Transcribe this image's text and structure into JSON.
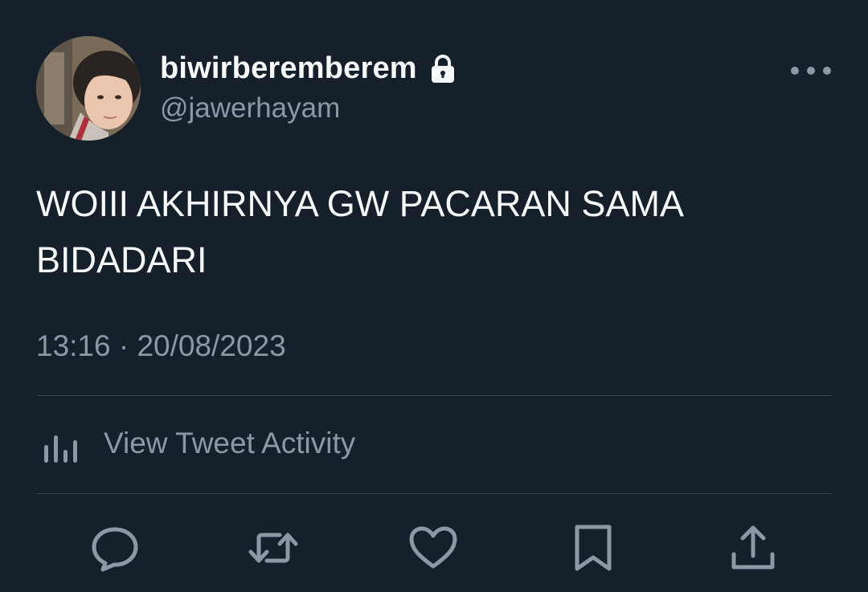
{
  "user": {
    "display_name": "biwirberemberem",
    "handle": "@jawerhayam",
    "protected_icon": "lock-icon",
    "avatar_icon": "avatar"
  },
  "tweet": {
    "text": "WOIII AKHIRNYA GW PACARAN SAMA BIDADARI",
    "timestamp": "13:16 · 20/08/2023"
  },
  "activity": {
    "icon": "bar-chart-icon",
    "label": "View Tweet Activity"
  },
  "actions": [
    {
      "name": "reply",
      "icon": "reply-icon"
    },
    {
      "name": "retweet",
      "icon": "retweet-icon"
    },
    {
      "name": "like",
      "icon": "heart-icon"
    },
    {
      "name": "bookmark",
      "icon": "bookmark-icon"
    },
    {
      "name": "share",
      "icon": "share-icon"
    }
  ],
  "colors": {
    "background": "#15202b",
    "primary_text": "#f7f9f9",
    "secondary_text": "#8b98a5",
    "divider": "#38444d"
  }
}
